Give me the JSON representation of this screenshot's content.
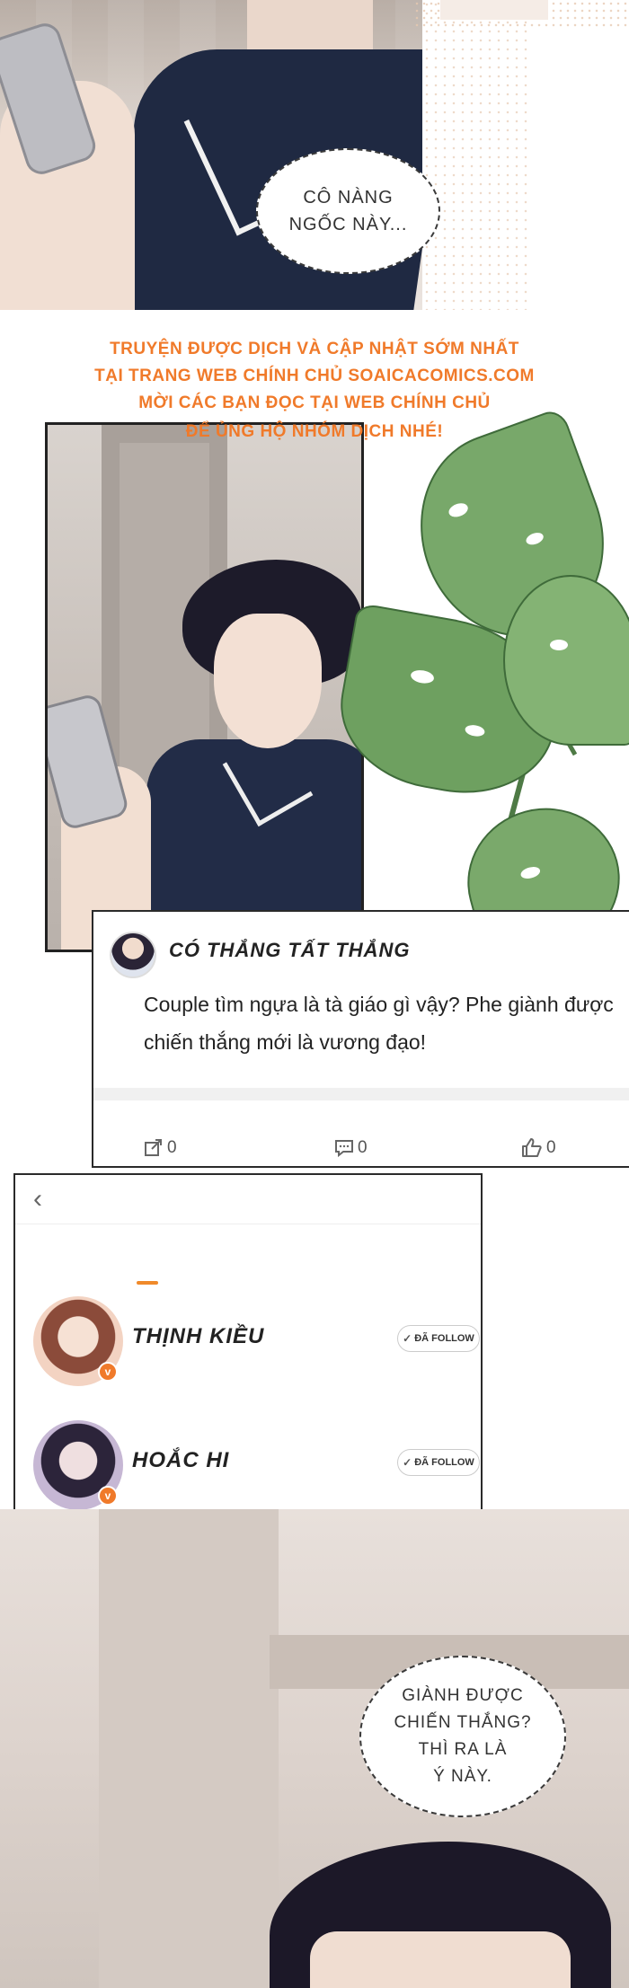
{
  "panel1": {
    "speech_bubble": "CÔ NÀNG\nNGỐC NÀY..."
  },
  "watermark": {
    "line1": "TRUYỆN ĐƯỢC DỊCH VÀ CẬP NHẬT SỚM NHẤT",
    "line2": "TẠI TRANG WEB CHÍNH CHỦ SOAICACOMICS.COM",
    "line3": "MỜI CÁC BẠN ĐỌC TẠI WEB CHÍNH CHỦ",
    "line4": "ĐỂ ỦNG HỘ NHÓM DỊCH NHÉ!",
    "color": "#f07a2a"
  },
  "comment_card": {
    "author": "CÓ THẮNG TẤT THẮNG",
    "text": "Couple tìm ngựa là tà giáo gì vậy? Phe giành được chiến thắng mới là vương đạo!",
    "actions": {
      "share_count": "0",
      "comment_count": "0",
      "like_count": "0"
    }
  },
  "follow_card": {
    "back_icon": "chevron-left-icon",
    "accent": "#f08a2a",
    "users": [
      {
        "name": "THỊNH KIỀU",
        "button_label": "ĐÃ FOLLOW",
        "badge": "v"
      },
      {
        "name": "HOẮC HI",
        "button_label": "ĐÃ FOLLOW",
        "badge": "v"
      }
    ]
  },
  "panel3": {
    "speech_bubble": "GIÀNH ĐƯỢC\nCHIẾN THẮNG?\nTHÌ RA LÀ\nÝ NÀY."
  }
}
